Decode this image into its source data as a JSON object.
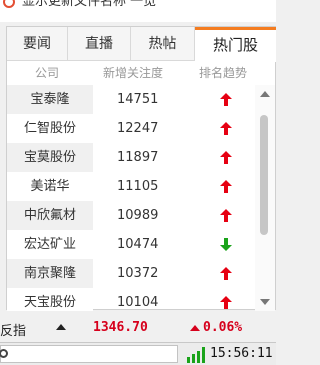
{
  "header": {
    "cut_text": "显示更新文件名称 一览"
  },
  "tabs": [
    {
      "label": "要闻"
    },
    {
      "label": "直播"
    },
    {
      "label": "热帖"
    },
    {
      "label": "热门股"
    }
  ],
  "table": {
    "columns": {
      "company": "公司",
      "new_attention": "新增关注度",
      "trend": "排名趋势"
    },
    "rows": [
      {
        "company": "宝泰隆",
        "value": "14751",
        "trend": "up"
      },
      {
        "company": "仁智股份",
        "value": "12247",
        "trend": "up"
      },
      {
        "company": "宝莫股份",
        "value": "11897",
        "trend": "up"
      },
      {
        "company": "美诺华",
        "value": "11105",
        "trend": "up"
      },
      {
        "company": "中欣氟材",
        "value": "10989",
        "trend": "up"
      },
      {
        "company": "宏达矿业",
        "value": "10474",
        "trend": "down"
      },
      {
        "company": "南京聚隆",
        "value": "10372",
        "trend": "up"
      },
      {
        "company": "天宝股份",
        "value": "10104",
        "trend": "up"
      }
    ]
  },
  "ticker": {
    "label": "反指",
    "price": "1346.70",
    "change": "0.06%"
  },
  "status": {
    "time": "15:56:11"
  },
  "colors": {
    "accent": "#f47c20",
    "up": "#e60012",
    "down": "#1aa31a",
    "price": "#d6001c"
  }
}
